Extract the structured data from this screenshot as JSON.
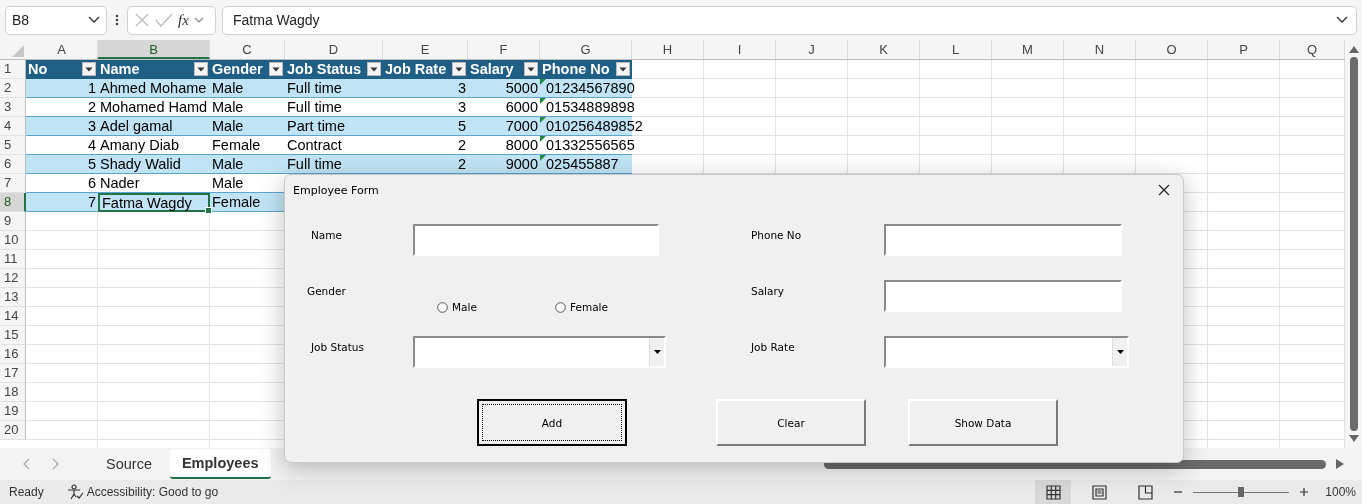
{
  "formula_bar": {
    "name_box": "B8",
    "function_label": "fx",
    "formula": "Fatma Wagdy"
  },
  "sheet": {
    "columns": [
      {
        "label": "A",
        "selected": false
      },
      {
        "label": "B",
        "selected": true
      },
      {
        "label": "C",
        "selected": false
      },
      {
        "label": "D",
        "selected": false
      },
      {
        "label": "E",
        "selected": false
      },
      {
        "label": "F",
        "selected": false
      },
      {
        "label": "G",
        "selected": false
      },
      {
        "label": "H",
        "selected": false
      },
      {
        "label": "I",
        "selected": false
      },
      {
        "label": "J",
        "selected": false
      },
      {
        "label": "K",
        "selected": false
      },
      {
        "label": "L",
        "selected": false
      },
      {
        "label": "M",
        "selected": false
      },
      {
        "label": "N",
        "selected": false
      },
      {
        "label": "O",
        "selected": false
      },
      {
        "label": "P",
        "selected": false
      },
      {
        "label": "Q",
        "selected": false
      }
    ],
    "rows": [
      {
        "number": "1",
        "kind": "header",
        "selected": false,
        "cells": [
          {
            "text": "No"
          },
          {
            "text": "Name"
          },
          {
            "text": "Gender"
          },
          {
            "text": "Job Status"
          },
          {
            "text": "Job Rate"
          },
          {
            "text": "Salary"
          },
          {
            "text": "Phone No"
          }
        ]
      },
      {
        "number": "2",
        "kind": "data",
        "banded": true,
        "selected": false,
        "cells": [
          {
            "text": "1",
            "kind": "number"
          },
          {
            "text": "Ahmed Mohame",
            "kind": "text"
          },
          {
            "text": "Male",
            "kind": "text"
          },
          {
            "text": "Full time",
            "kind": "text"
          },
          {
            "text": "3",
            "kind": "number"
          },
          {
            "text": "5000",
            "kind": "number"
          },
          {
            "text": "01234567890",
            "kind": "text",
            "warning": true
          }
        ]
      },
      {
        "number": "3",
        "kind": "data",
        "banded": false,
        "selected": false,
        "cells": [
          {
            "text": "2",
            "kind": "number"
          },
          {
            "text": "Mohamed Hamd",
            "kind": "text"
          },
          {
            "text": "Male",
            "kind": "text"
          },
          {
            "text": "Full time",
            "kind": "text"
          },
          {
            "text": "3",
            "kind": "number"
          },
          {
            "text": "6000",
            "kind": "number"
          },
          {
            "text": "01534889898",
            "kind": "text",
            "warning": true
          }
        ]
      },
      {
        "number": "4",
        "kind": "data",
        "banded": true,
        "selected": false,
        "cells": [
          {
            "text": "3",
            "kind": "number"
          },
          {
            "text": "Adel gamal",
            "kind": "text"
          },
          {
            "text": "Male",
            "kind": "text"
          },
          {
            "text": "Part time",
            "kind": "text"
          },
          {
            "text": "5",
            "kind": "number"
          },
          {
            "text": "7000",
            "kind": "number"
          },
          {
            "text": "010256489852",
            "kind": "text",
            "warning": true
          }
        ]
      },
      {
        "number": "5",
        "kind": "data",
        "banded": false,
        "selected": false,
        "cells": [
          {
            "text": "4",
            "kind": "number"
          },
          {
            "text": "Amany Diab",
            "kind": "text"
          },
          {
            "text": "Female",
            "kind": "text"
          },
          {
            "text": "Contract",
            "kind": "text"
          },
          {
            "text": "2",
            "kind": "number"
          },
          {
            "text": "8000",
            "kind": "number"
          },
          {
            "text": "01332556565",
            "kind": "text",
            "warning": true
          }
        ]
      },
      {
        "number": "6",
        "kind": "data",
        "banded": true,
        "selected": false,
        "cells": [
          {
            "text": "5",
            "kind": "number"
          },
          {
            "text": "Shady Walid",
            "kind": "text"
          },
          {
            "text": "Male",
            "kind": "text"
          },
          {
            "text": "Full time",
            "kind": "text"
          },
          {
            "text": "2",
            "kind": "number"
          },
          {
            "text": "9000",
            "kind": "number"
          },
          {
            "text": "025455887",
            "kind": "text",
            "warning": true
          }
        ]
      },
      {
        "number": "7",
        "kind": "data",
        "banded": false,
        "selected": false,
        "cells": [
          {
            "text": "6",
            "kind": "number"
          },
          {
            "text": "Nader",
            "kind": "text"
          },
          {
            "text": "Male",
            "kind": "text"
          }
        ]
      },
      {
        "number": "8",
        "kind": "data",
        "banded": true,
        "selected": true,
        "cells": [
          {
            "text": "7",
            "kind": "number"
          },
          {
            "text": "Fatma Wagdy",
            "kind": "text"
          },
          {
            "text": "Female",
            "kind": "text"
          }
        ]
      },
      {
        "number": "9",
        "kind": "empty",
        "selected": false
      },
      {
        "number": "10",
        "kind": "empty",
        "selected": false
      },
      {
        "number": "11",
        "kind": "empty",
        "selected": false
      },
      {
        "number": "12",
        "kind": "empty",
        "selected": false
      },
      {
        "number": "13",
        "kind": "empty",
        "selected": false
      },
      {
        "number": "14",
        "kind": "empty",
        "selected": false
      },
      {
        "number": "15",
        "kind": "empty",
        "selected": false
      },
      {
        "number": "16",
        "kind": "empty",
        "selected": false
      },
      {
        "number": "17",
        "kind": "empty",
        "selected": false
      },
      {
        "number": "18",
        "kind": "empty",
        "selected": false
      },
      {
        "number": "19",
        "kind": "empty",
        "selected": false
      },
      {
        "number": "20",
        "kind": "empty",
        "selected": false
      }
    ]
  },
  "sheet_tabs": [
    {
      "label": "Source",
      "selected": false
    },
    {
      "label": "Employees",
      "selected": true
    }
  ],
  "dialog": {
    "title": "Employee Form",
    "fields": [
      {
        "label": "Name",
        "kind": "text"
      },
      {
        "label": "Phone No",
        "kind": "text"
      },
      {
        "label": "Gender",
        "kind": "radio",
        "options": [
          {
            "label": "Male",
            "selected": false
          },
          {
            "label": "Female",
            "selected": false
          }
        ]
      },
      {
        "label": "Salary",
        "kind": "text"
      },
      {
        "label": "Job Status",
        "kind": "combo"
      },
      {
        "label": "Job Rate",
        "kind": "combo"
      }
    ],
    "buttons": [
      {
        "label": "Add",
        "focused": true
      },
      {
        "label": "Clear",
        "focused": false
      },
      {
        "label": "Show Data",
        "focused": false
      }
    ]
  },
  "status_bar": {
    "status": "Ready",
    "accessibility": "Accessibility: Good to go",
    "views": [
      {
        "kind": "normal",
        "selected": true
      },
      {
        "kind": "page_layout",
        "selected": false
      },
      {
        "kind": "page_break",
        "selected": false
      }
    ],
    "zoom": {
      "level": 0.5,
      "reading": "100%"
    }
  }
}
